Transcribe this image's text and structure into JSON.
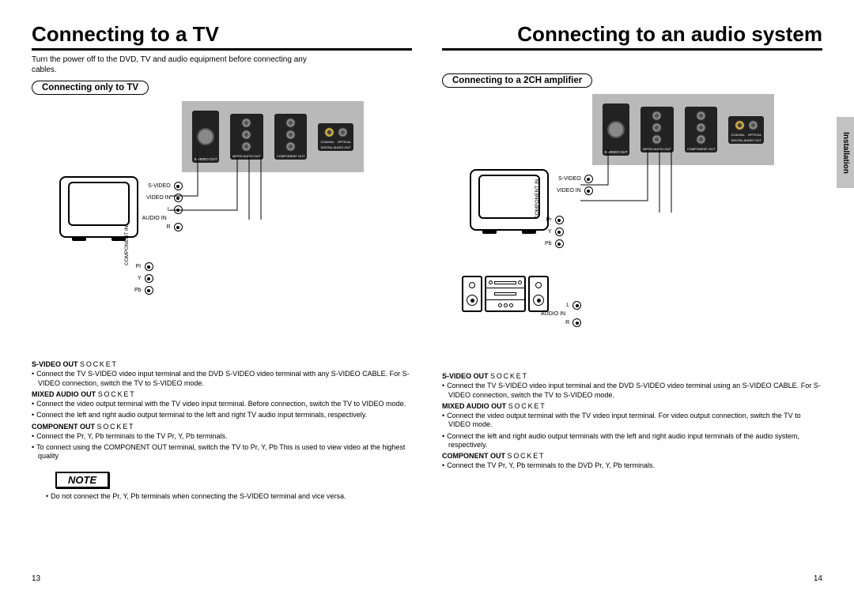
{
  "left": {
    "title": "Connecting to a TV",
    "intro": "Turn the power off to the DVD, TV and audio equipment before connecting any cables.",
    "subheading": "Connecting only to TV",
    "panel": {
      "svideo_out": "S-VIDEO OUT",
      "mixed": "MIXED AUDIO OUT",
      "component": "COMPONENT OUT",
      "digital": "DIGITAL AUDIO OUT",
      "coaxial": "COAXIAL",
      "optical": "OPTICAL"
    },
    "tv_terms": {
      "svideo": "S-VIDEO",
      "video_in": "VIDEO IN",
      "audio_in": "AUDIO IN",
      "l": "L",
      "r": "R",
      "component_in": "COMPONENT IN",
      "pr": "Pr",
      "y": "Y",
      "pb": "Pb"
    },
    "sockets": {
      "h1a": "S-VIDEO OUT",
      "h1b": "SOCKET",
      "b1": "Connect the TV S-VIDEO video input terminal and the DVD S-VIDEO video terminal with any S-VIDEO CABLE. For S-VIDEO connection, switch the TV to S-VIDEO mode.",
      "h2a": "MIXED AUDIO OUT",
      "h2b": "SOCKET",
      "b2a": "Connect the video output terminal with the TV video input terminal. Before connection, switch the TV to VIDEO mode.",
      "b2b": "Connect the left and right audio output terminal to the left and right TV audio input terminals, respectively.",
      "h3a": "COMPONENT OUT",
      "h3b": "SOCKET",
      "b3a": "Connect the Pr, Y, Pb terminals to the TV Pr, Y, Pb terminals.",
      "b3b": "To connect using the COMPONENT OUT terminal, switch the TV to Pr, Y, Pb This is used to view video at the highest quality"
    },
    "note_label": "NOTE",
    "note_body": "Do not connect the Pr, Y, Pb terminals when connecting the S-VIDEO terminal and vice versa.",
    "page": "13"
  },
  "right": {
    "title": "Connecting to an audio system",
    "subheading": "Connecting to a 2CH amplifier",
    "side_tab": "Installation",
    "panel": {
      "svideo_out": "S-VIDEO OUT",
      "mixed": "MIXED AUDIO OUT",
      "component": "COMPONENT OUT",
      "digital": "DIGITAL AUDIO OUT",
      "coaxial": "COAXIAL",
      "optical": "OPTICAL"
    },
    "tv_terms": {
      "svideo": "S-VIDEO",
      "video_in": "VIDEO IN",
      "audio_in": "AUDIO IN",
      "l": "L",
      "r": "R",
      "component_in": "COMPONENT IN",
      "pr": "Pr",
      "y": "Y",
      "pb": "Pb"
    },
    "sockets": {
      "h1a": "S-VIDEO OUT",
      "h1b": "SOCKET",
      "b1": "Connect the TV S-VIDEO video input terminal and the DVD S-VIDEO video terminal using an S-VIDEO CABLE. For S-VIDEO connection, switch the TV to S-VIDEO mode.",
      "h2a": "MIXED AUDIO OUT",
      "h2b": "SOCKET",
      "b2a": "Connect the video output terminal with the TV video input terminal. For video output connection, switch the TV to VIDEO mode.",
      "b2b": "Connect the left and right audio output terminals with the left and right audio input terminals of the audio system, respectively.",
      "h3a": "COMPONENT OUT",
      "h3b": "SOCKET",
      "b3a": "Connect the TV Pr, Y, Pb terminals to the DVD Pr, Y, Pb terminals."
    },
    "page": "14"
  }
}
